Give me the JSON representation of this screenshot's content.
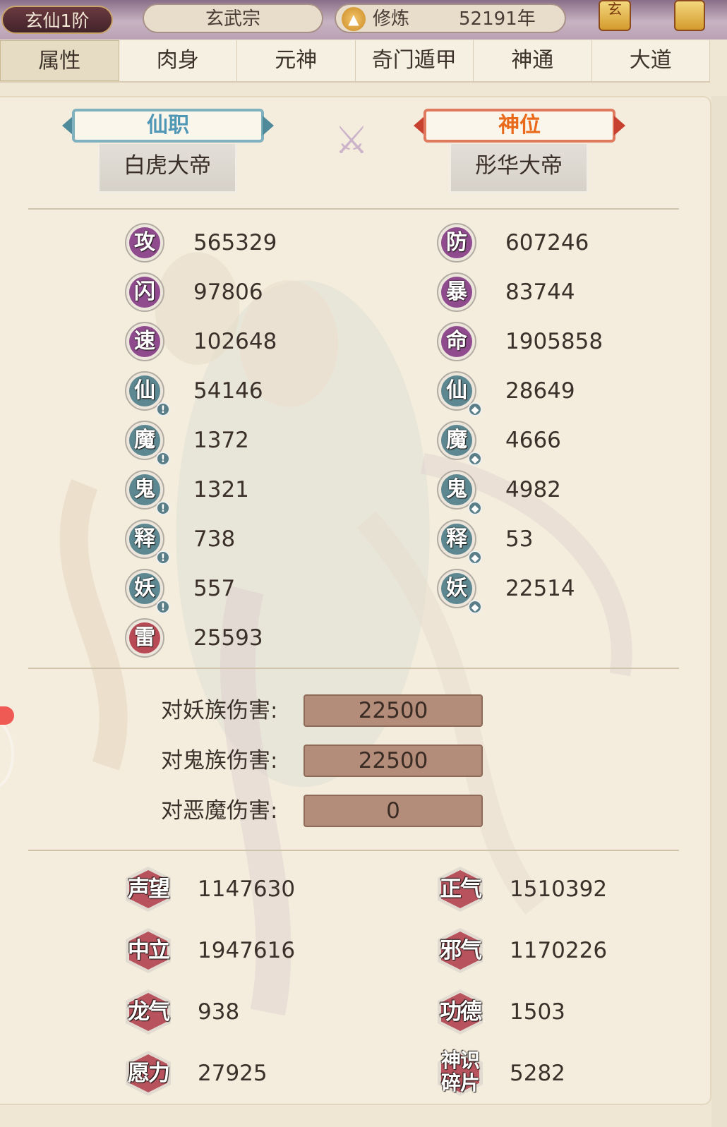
{
  "header": {
    "rank": "玄仙1阶",
    "sect": "玄武宗",
    "cultivation_label": "修炼",
    "cultivation_value": "52191年",
    "lantern_1": "玄",
    "colors": {
      "accent": "#8f4b8e",
      "teal": "#5d8891",
      "red": "#b84a55"
    }
  },
  "tabs": [
    "属性",
    "肉身",
    "元神",
    "奇门遁甲",
    "神通",
    "大道"
  ],
  "titles": {
    "left_banner": "仙职",
    "left_title": "白虎大帝",
    "right_banner": "神位",
    "right_title": "彤华大帝"
  },
  "stats_left": [
    {
      "icon": "攻",
      "value": "565329"
    },
    {
      "icon": "闪",
      "value": "97806"
    },
    {
      "icon": "速",
      "value": "102648"
    },
    {
      "icon": "仙",
      "value": "54146"
    },
    {
      "icon": "魔",
      "value": "1372"
    },
    {
      "icon": "鬼",
      "value": "1321"
    },
    {
      "icon": "释",
      "value": "738"
    },
    {
      "icon": "妖",
      "value": "557"
    },
    {
      "icon": "雷",
      "value": "25593"
    }
  ],
  "stats_right": [
    {
      "icon": "防",
      "value": "607246"
    },
    {
      "icon": "暴",
      "value": "83744"
    },
    {
      "icon": "命",
      "value": "1905858"
    },
    {
      "icon": "仙",
      "value": "28649"
    },
    {
      "icon": "魔",
      "value": "4666"
    },
    {
      "icon": "鬼",
      "value": "4982"
    },
    {
      "icon": "释",
      "value": "53"
    },
    {
      "icon": "妖",
      "value": "22514"
    }
  ],
  "damage": [
    {
      "label": "对妖族伤害:",
      "value": "22500"
    },
    {
      "label": "对鬼族伤害:",
      "value": "22500"
    },
    {
      "label": "对恶魔伤害:",
      "value": "0"
    }
  ],
  "extra_left": [
    {
      "icon": "声望",
      "value": "1147630"
    },
    {
      "icon": "中立",
      "value": "1947616"
    },
    {
      "icon": "龙气",
      "value": "938"
    },
    {
      "icon": "愿力",
      "value": "27925"
    }
  ],
  "extra_right": [
    {
      "icon": "正气",
      "value": "1510392"
    },
    {
      "icon": "邪气",
      "value": "1170226"
    },
    {
      "icon": "功德",
      "value": "1503"
    },
    {
      "icon": "神识碎片",
      "value": "5282"
    }
  ]
}
